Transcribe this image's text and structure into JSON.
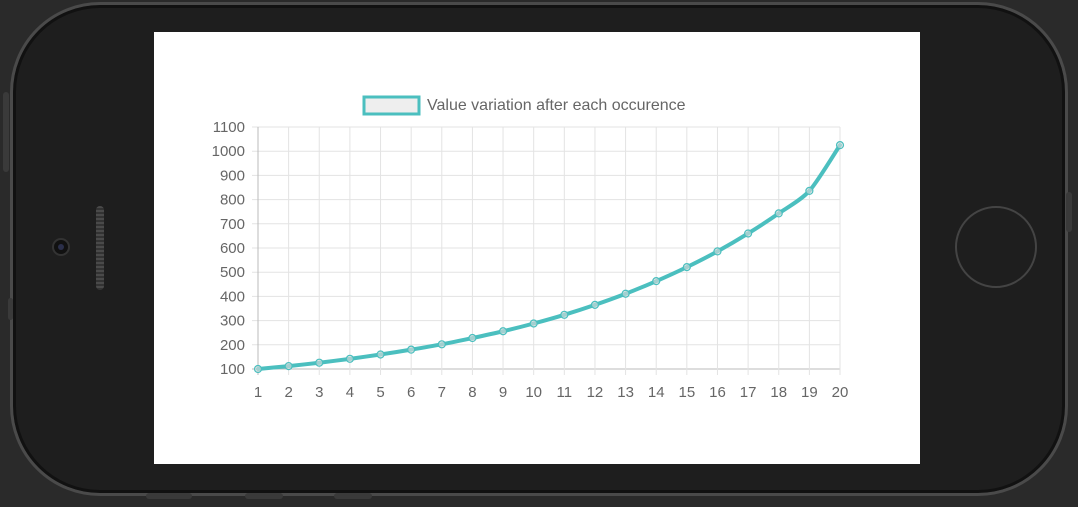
{
  "chart_data": {
    "type": "line",
    "legend_label": "Value variation after each occurence",
    "legend_position": "top",
    "grid": true,
    "x": [
      1,
      2,
      3,
      4,
      5,
      6,
      7,
      8,
      9,
      10,
      11,
      12,
      13,
      14,
      15,
      16,
      17,
      18,
      19,
      20
    ],
    "y_ticks": [
      100,
      200,
      300,
      400,
      500,
      600,
      700,
      800,
      900,
      1000,
      1100
    ],
    "ylim": [
      100,
      1100
    ],
    "series": [
      {
        "name": "Value variation after each occurence",
        "values": [
          100,
          112,
          126,
          142,
          160,
          180,
          202,
          228,
          256,
          288,
          324,
          365,
          411,
          463,
          521,
          586,
          660,
          743,
          836,
          1025
        ],
        "color": "#4bbfbf"
      }
    ]
  }
}
